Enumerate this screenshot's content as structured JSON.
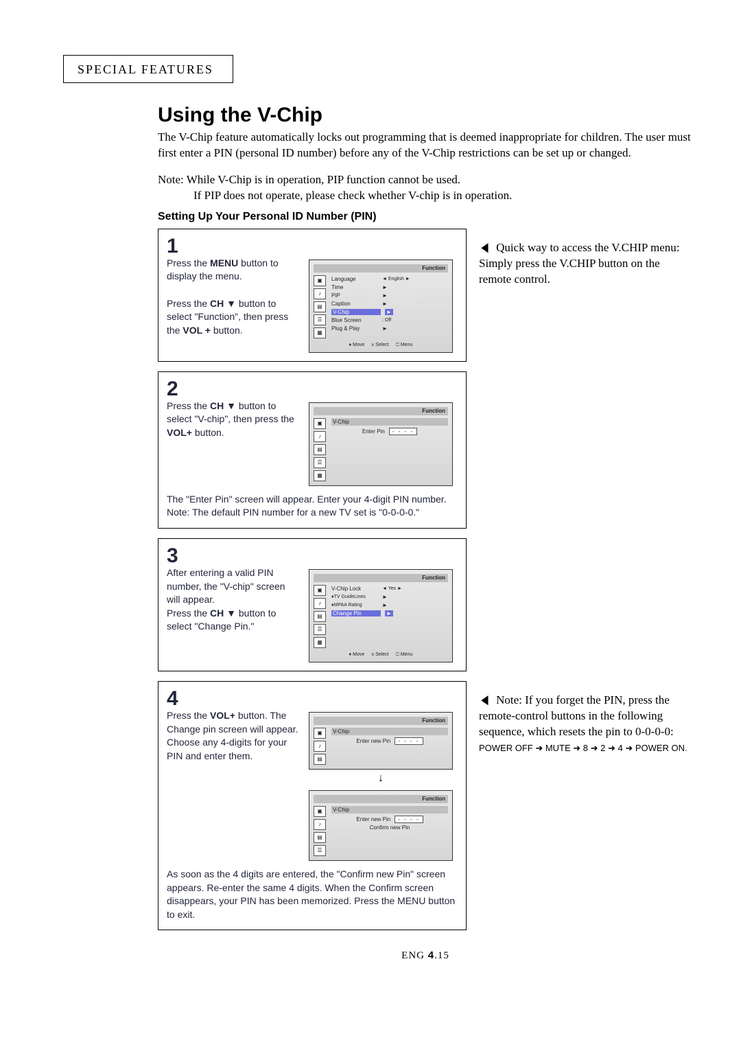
{
  "header": {
    "text": "SPECIAL FEATURES"
  },
  "title": "Using the V-Chip",
  "intro": "The V-Chip feature automatically locks out programming that is deemed inappropriate for children. The user must first enter a PIN (personal ID number) before any of the V-Chip restrictions can be set up or changed.",
  "note_line1": "Note:  While V-Chip is in operation, PIP function cannot be used.",
  "note_line2": "If PIP does not operate, please check whether V-chip is in operation.",
  "subhead": "Setting Up Your Personal ID Number (PIN)",
  "side1": "Quick way to access the V.CHIP menu: Simply press the V.CHIP button on the remote control.",
  "side4_a": "Note: If you forget the PIN, press the remote-control buttons in the following sequence, which resets the pin to 0-0-0-0:",
  "side4_b": "POWER OFF ➜ MUTE ➜ 8 ➜ 2 ➜ 4 ➜ POWER ON.",
  "step1": {
    "num": "1",
    "t1a": "Press the ",
    "t1b": "MENU",
    "t1c": " button to display the menu.",
    "t2a": "Press the ",
    "t2b": "CH ▼",
    "t2c": " button to select \"Function\", then press the ",
    "t2d": "VOL +",
    "t2e": " button."
  },
  "step2": {
    "num": "2",
    "t1a": "Press the ",
    "t1b": "CH ▼",
    "t1c": " button to select \"V-chip\", then press the ",
    "t1d": "VOL+",
    "t1e": " button.",
    "foot_a": "The \"Enter Pin\" screen will appear. Enter your 4-digit PIN number. Note: The default PIN number for a new TV set is ",
    "foot_b": "\"0-0-0-0.\""
  },
  "step3": {
    "num": "3",
    "t1a": "After entering a valid PIN number, the \"V-chip\" screen will appear.",
    "t2a": "Press the ",
    "t2b": "CH ▼",
    "t2c": " button to select \"Change Pin.\""
  },
  "step4": {
    "num": "4",
    "t1a": "Press the  ",
    "t1b": "VOL+",
    "t1c": " button. The Change pin screen will appear. Choose any 4-digits for your PIN and enter them.",
    "foot_a": "As soon as the 4 digits are entered, the \"Confirm new Pin\" screen appears. Re-enter the same 4 digits. When the Confirm screen disappears, your PIN has been memorized. Press the ",
    "foot_b": "MENU",
    "foot_c": " button to exit."
  },
  "osd": {
    "function": "Function",
    "language": "Language",
    "english": "English",
    "time": "Time",
    "pip": "PIP",
    "caption": "Caption",
    "vchip": "V-Chip",
    "blue": "Blue Screen",
    "off": "Off",
    "plug": "Plug & Play",
    "move": "Move",
    "select": "Select",
    "menu": "Menu",
    "enterpin": "Enter Pin",
    "dots": "- - - -",
    "vcl": "V-Chip Lock",
    "yes": "Yes",
    "tvg": "TV GuideLines",
    "mpaa": "MPAA Rating",
    "change": "Change Pin",
    "enternew": "Enter new Pin",
    "confirm": "Confirm new Pin"
  },
  "pagefoot": {
    "a": "ENG ",
    "b": "4",
    "c": ".15"
  }
}
